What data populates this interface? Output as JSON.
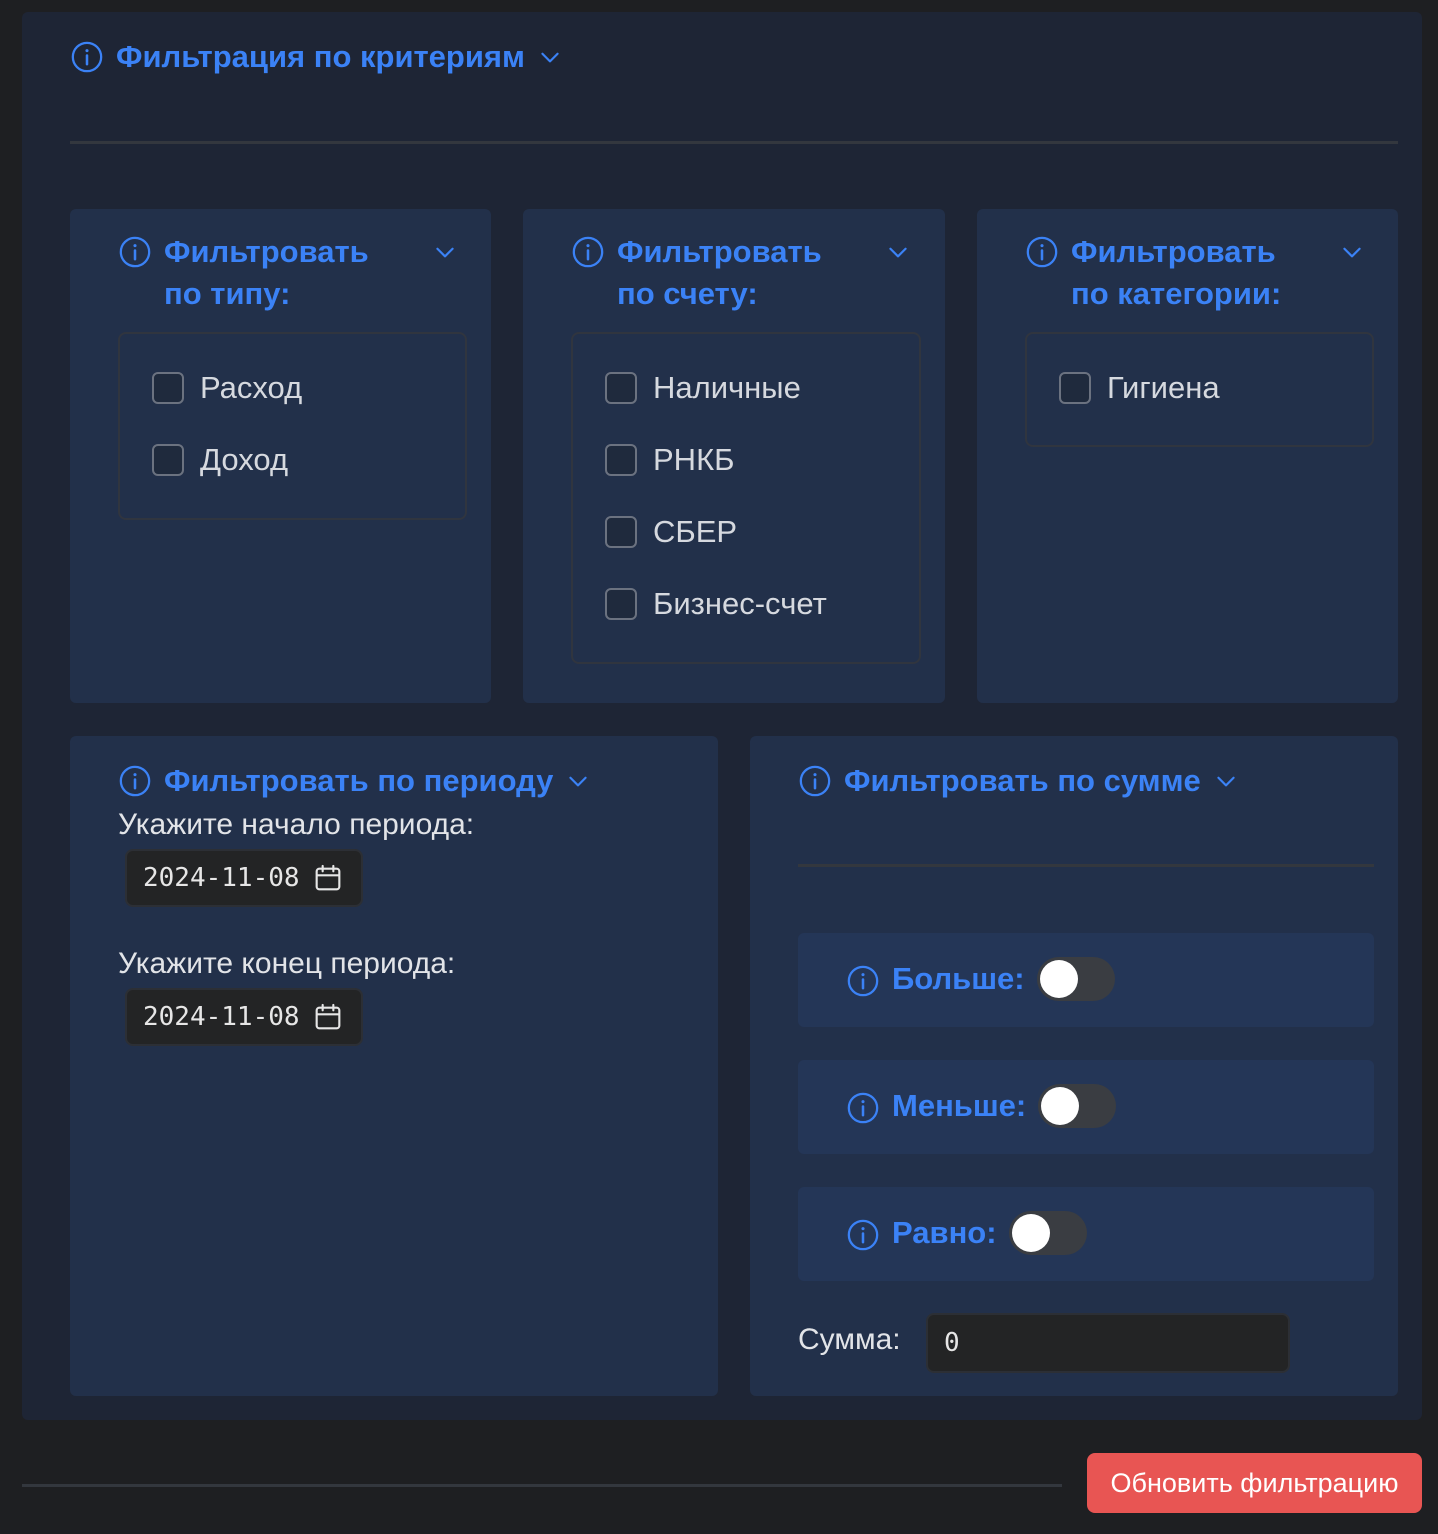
{
  "main": {
    "title": "Фильтрация по критериям"
  },
  "type_filter": {
    "title_line1": "Фильтровать",
    "title_line2": "по типу:",
    "options": [
      "Расход",
      "Доход"
    ]
  },
  "account_filter": {
    "title_line1": "Фильтровать",
    "title_line2": "по счету:",
    "options": [
      "Наличные",
      "РНКБ",
      "СБЕР",
      "Бизнес-счет"
    ]
  },
  "category_filter": {
    "title_line1": "Фильтровать",
    "title_line2": "по категории:",
    "options": [
      "Гигиена"
    ]
  },
  "period_filter": {
    "title": "Фильтровать по периоду",
    "start_label": "Укажите начало периода:",
    "start_value": "2024-11-08",
    "end_label": "Укажите конец периода:",
    "end_value": "2024-11-08"
  },
  "sum_filter": {
    "title": "Фильтровать по сумме",
    "greater_label": "Больше:",
    "less_label": "Меньше:",
    "equal_label": "Равно:",
    "sum_label": "Сумма:",
    "sum_value": "0"
  },
  "actions": {
    "update_label": "Обновить фильтрацию"
  }
}
